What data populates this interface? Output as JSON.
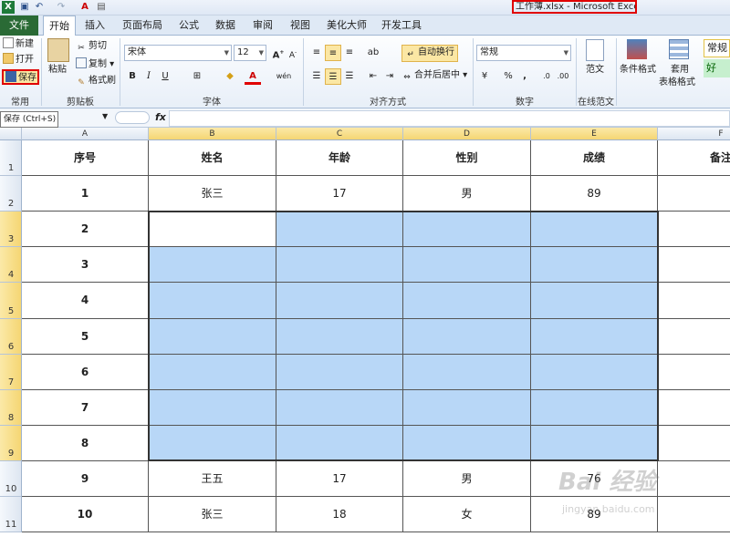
{
  "window": {
    "title": "工作薄.xlsx - Microsoft Excel"
  },
  "quick_access": {
    "icons": [
      "excel-logo-icon",
      "save-icon",
      "undo-icon",
      "redo-icon",
      "font-color-icon",
      "print-preview-icon"
    ]
  },
  "tabs": {
    "file": "文件",
    "items": [
      "开始",
      "插入",
      "页面布局",
      "公式",
      "数据",
      "审阅",
      "视图",
      "美化大师",
      "开发工具"
    ],
    "active_index": 0
  },
  "ribbon": {
    "common_group": {
      "new_label": "新建",
      "open_label": "打开",
      "save_label": "保存",
      "group_label": "常用"
    },
    "clipboard": {
      "paste_label": "粘贴",
      "cut_label": "剪切",
      "copy_label": "复制",
      "format_painter_label": "格式刷",
      "group_label": "剪贴板"
    },
    "font": {
      "font_name": "宋体",
      "font_size": "12",
      "bold": "B",
      "italic": "I",
      "underline": "U",
      "group_label": "字体"
    },
    "alignment": {
      "wrap_text_label": "自动换行",
      "merge_center_label": "合并后居中",
      "group_label": "对齐方式"
    },
    "number": {
      "format": "常规",
      "percent": "%",
      "comma": ",",
      "group_label": "数字"
    },
    "online_template": {
      "fanwen_label": "范文",
      "group_label": "在线范文"
    },
    "styles": {
      "conditional_format_label": "条件格式",
      "table_format_label": "套用",
      "table_format_label2": "表格格式",
      "normal_style": "常规",
      "good_style": "好"
    }
  },
  "formula_bar": {
    "tooltip": "保存 (Ctrl+S)",
    "fx": "fx",
    "value": ""
  },
  "sheet": {
    "column_headers": [
      "A",
      "B",
      "C",
      "D",
      "E",
      "F"
    ],
    "selected_columns": [
      "B",
      "C",
      "D",
      "E"
    ],
    "row_headers": [
      "1",
      "2",
      "3",
      "4",
      "5",
      "6",
      "7",
      "8",
      "9",
      "10",
      "11"
    ],
    "selected_rows": [
      "3",
      "4",
      "5",
      "6",
      "7",
      "8",
      "9"
    ],
    "rows": [
      [
        "序号",
        "姓名",
        "年龄",
        "性别",
        "成绩",
        "备注"
      ],
      [
        "1",
        "张三",
        "17",
        "男",
        "89",
        ""
      ],
      [
        "2",
        "",
        "",
        "",
        "",
        ""
      ],
      [
        "3",
        "",
        "",
        "",
        "",
        ""
      ],
      [
        "4",
        "",
        "",
        "",
        "",
        ""
      ],
      [
        "5",
        "",
        "",
        "",
        "",
        ""
      ],
      [
        "6",
        "",
        "",
        "",
        "",
        ""
      ],
      [
        "7",
        "",
        "",
        "",
        "",
        ""
      ],
      [
        "8",
        "",
        "",
        "",
        "",
        ""
      ],
      [
        "9",
        "王五",
        "17",
        "男",
        "76",
        ""
      ],
      [
        "10",
        "张三",
        "18",
        "女",
        "89",
        ""
      ]
    ]
  },
  "watermark": {
    "main": "Bai 经验",
    "sub": "jingyan.baidu.com"
  },
  "colors": {
    "selection_fill": "#b8d7f7",
    "header_highlight": "#f5d673",
    "file_tab": "#2a6a35",
    "annotation_red": "#e00000"
  }
}
